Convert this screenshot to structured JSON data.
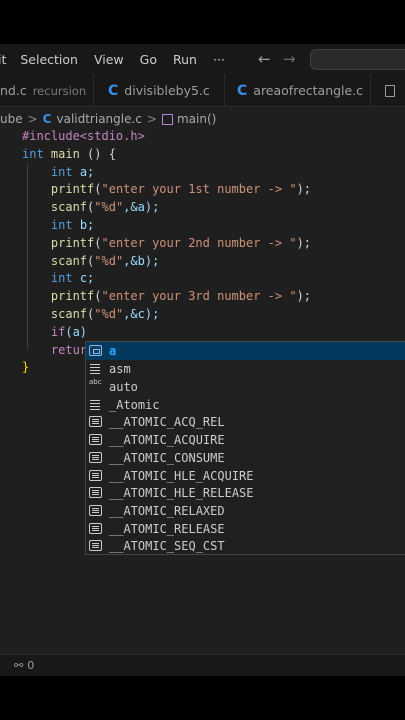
{
  "menu": [
    "it",
    "Selection",
    "View",
    "Go",
    "Run",
    "···"
  ],
  "nav": {
    "back": "←",
    "forward": "→"
  },
  "tabs": [
    {
      "name": "nd.c",
      "desc": "recursion"
    },
    {
      "name": "divisibleby5.c"
    },
    {
      "name": "areaofrectangle.c"
    }
  ],
  "breadcrumb": {
    "folder": "ube",
    "file": "validtriangle.c",
    "symbol": "main()"
  },
  "code": {
    "line1": "#include<stdio.h>",
    "main_kw": "int",
    "main_name": "main",
    "main_rest": " () {",
    "l_int": "int",
    "l_a": "a;",
    "l_b": "b;",
    "l_c": "c;",
    "printf": "printf",
    "p1_str": "\"enter your 1st number -> \"",
    "p2_str": "\"enter your 2nd number -> \"",
    "p3_str": "\"enter your 3rd number -> \"",
    "scanf": "scanf",
    "fmt": "\"%d\"",
    "s1_arg": ",&a);",
    "s2_arg": ",&b);",
    "s3_arg": ",&c);",
    "if_kw": "if",
    "if_rest": "(a)",
    "return_partial": "retur",
    "close": "}"
  },
  "suggestions": [
    {
      "label": "a",
      "icon": "variable-icon",
      "selected": true
    },
    {
      "label": "asm",
      "icon": "keyword-icon"
    },
    {
      "label": "auto",
      "icon": "text-icon"
    },
    {
      "label": "_Atomic",
      "icon": "keyword-icon"
    },
    {
      "label": "__ATOMIC_ACQ_REL",
      "icon": "snippet-icon"
    },
    {
      "label": "__ATOMIC_ACQUIRE",
      "icon": "snippet-icon"
    },
    {
      "label": "__ATOMIC_CONSUME",
      "icon": "snippet-icon"
    },
    {
      "label": "__ATOMIC_HLE_ACQUIRE",
      "icon": "snippet-icon"
    },
    {
      "label": "__ATOMIC_HLE_RELEASE",
      "icon": "snippet-icon"
    },
    {
      "label": "__ATOMIC_RELAXED",
      "icon": "snippet-icon"
    },
    {
      "label": "__ATOMIC_RELEASE",
      "icon": "snippet-icon"
    },
    {
      "label": "__ATOMIC_SEQ_CST",
      "icon": "snippet-icon"
    }
  ],
  "status": {
    "ports": "0"
  }
}
